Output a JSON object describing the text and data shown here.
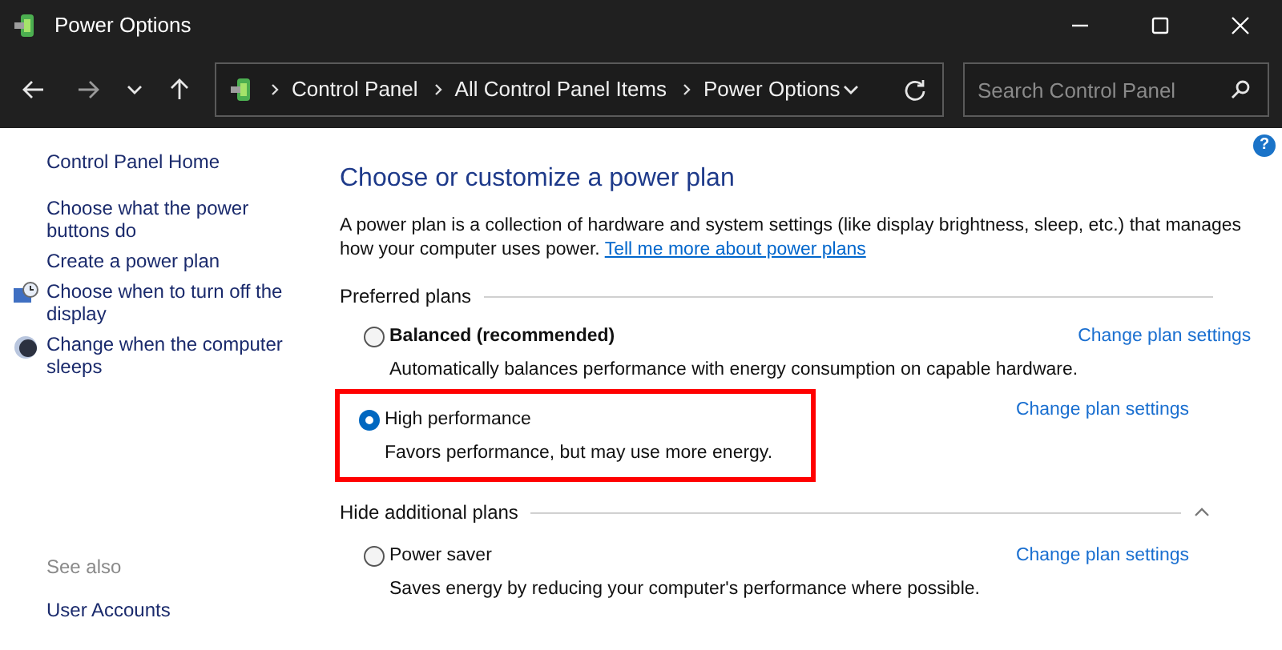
{
  "window": {
    "title": "Power Options"
  },
  "address_bar": {
    "crumbs": [
      "Control Panel",
      "All Control Panel Items",
      "Power Options"
    ]
  },
  "search": {
    "placeholder": "Search Control Panel"
  },
  "help_button": {
    "label": "?"
  },
  "sidebar": {
    "items": [
      {
        "label": "Control Panel Home",
        "kind": "home"
      },
      {
        "label": "Choose what the power buttons do",
        "kind": "link"
      },
      {
        "label": "Create a power plan",
        "kind": "link"
      },
      {
        "label": "Choose when to turn off the display",
        "kind": "display"
      },
      {
        "label": "Change when the computer sleeps",
        "kind": "sleep"
      }
    ],
    "see_also": {
      "heading": "See also",
      "items": [
        "User Accounts"
      ]
    }
  },
  "main": {
    "title": "Choose or customize a power plan",
    "intro": "A power plan is a collection of hardware and system settings (like display brightness, sleep, etc.) that manages how your computer uses power.",
    "intro_link": "Tell me more about power plans",
    "groups": [
      {
        "heading": "Preferred plans",
        "collapse": false,
        "plans": [
          {
            "name": "Balanced (recommended)",
            "bold": true,
            "selected": false,
            "highlighted": false,
            "description": "Automatically balances performance with energy consumption on capable hardware.",
            "link": "Change plan settings"
          },
          {
            "name": "High performance",
            "bold": false,
            "selected": true,
            "highlighted": true,
            "description": "Favors performance, but may use more energy.",
            "link": "Change plan settings"
          }
        ]
      },
      {
        "heading": "Hide additional plans",
        "collapse": true,
        "plans": [
          {
            "name": "Power saver",
            "bold": false,
            "selected": false,
            "highlighted": false,
            "description": "Saves energy by reducing your computer's performance where possible.",
            "link": "Change plan settings"
          }
        ]
      }
    ]
  }
}
